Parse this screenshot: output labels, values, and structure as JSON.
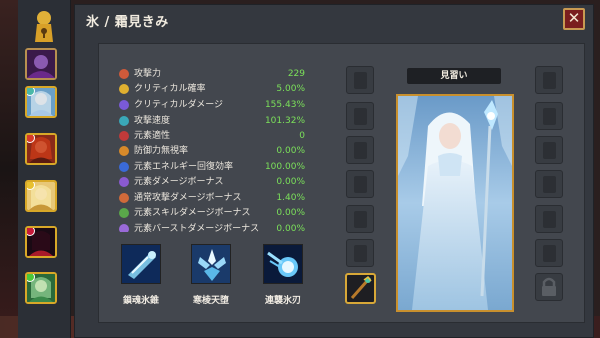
{
  "window": {
    "title": "氷 / 霜見きみ",
    "close_symbol": "✕"
  },
  "rank_label": "見習い",
  "stats": [
    {
      "label": "攻撃力",
      "value": "229",
      "icon": "sword-icon",
      "color": "#d05a3a"
    },
    {
      "label": "クリティカル確率",
      "value": "5.00%",
      "icon": "star-icon",
      "color": "#e0b030"
    },
    {
      "label": "クリティカルダメージ",
      "value": "155.43%",
      "icon": "burst-icon",
      "color": "#7a5ad8"
    },
    {
      "label": "攻撃速度",
      "value": "101.32%",
      "icon": "speed-icon",
      "color": "#3aa8b8"
    },
    {
      "label": "元素適性",
      "value": "0",
      "icon": "element-icon",
      "color": "#c03a3a"
    },
    {
      "label": "防御力無視率",
      "value": "0.00%",
      "icon": "pierce-icon",
      "color": "#d88a2a"
    },
    {
      "label": "元素エネルギー回復効率",
      "value": "100.00%",
      "icon": "energy-icon",
      "color": "#3a6ad8"
    },
    {
      "label": "元素ダメージボーナス",
      "value": "0.00%",
      "icon": "element-damage-icon",
      "color": "#8a5ad0"
    },
    {
      "label": "通常攻撃ダメージボーナス",
      "value": "1.40%",
      "icon": "attack-bonus-icon",
      "color": "#d06a3a"
    },
    {
      "label": "元素スキルダメージボーナス",
      "value": "0.00%",
      "icon": "skill-bonus-icon",
      "color": "#5aa84a"
    },
    {
      "label": "元素バーストダメージボーナス",
      "value": "0.00%",
      "icon": "burst-bonus-icon",
      "color": "#9a6ad8"
    }
  ],
  "skills": [
    {
      "name": "鎖魂氷錐",
      "icon": "ice-spike-skill-icon"
    },
    {
      "name": "寒棱天堕",
      "icon": "ice-shards-skill-icon"
    },
    {
      "name": "連襲氷刃",
      "icon": "ice-comet-skill-icon"
    }
  ],
  "equipment_icons": {
    "left": [
      "weapon-slot-icon",
      "chest-slot-icon",
      "gloves-slot-icon",
      "leg-slot-icon",
      "boots-slot-icon",
      "ring-slot-icon",
      "staff-item-icon"
    ],
    "right": [
      "helmet-slot-icon",
      "shoulder-slot-icon",
      "belt-slot-icon",
      "gauntlet-slot-icon",
      "amulet-slot-icon",
      "bracer-slot-icon",
      "lock-icon"
    ]
  },
  "colors": {
    "accent_gold": "#c8902e",
    "value_green": "#7be05a",
    "close_red": "#7a1e1e"
  }
}
